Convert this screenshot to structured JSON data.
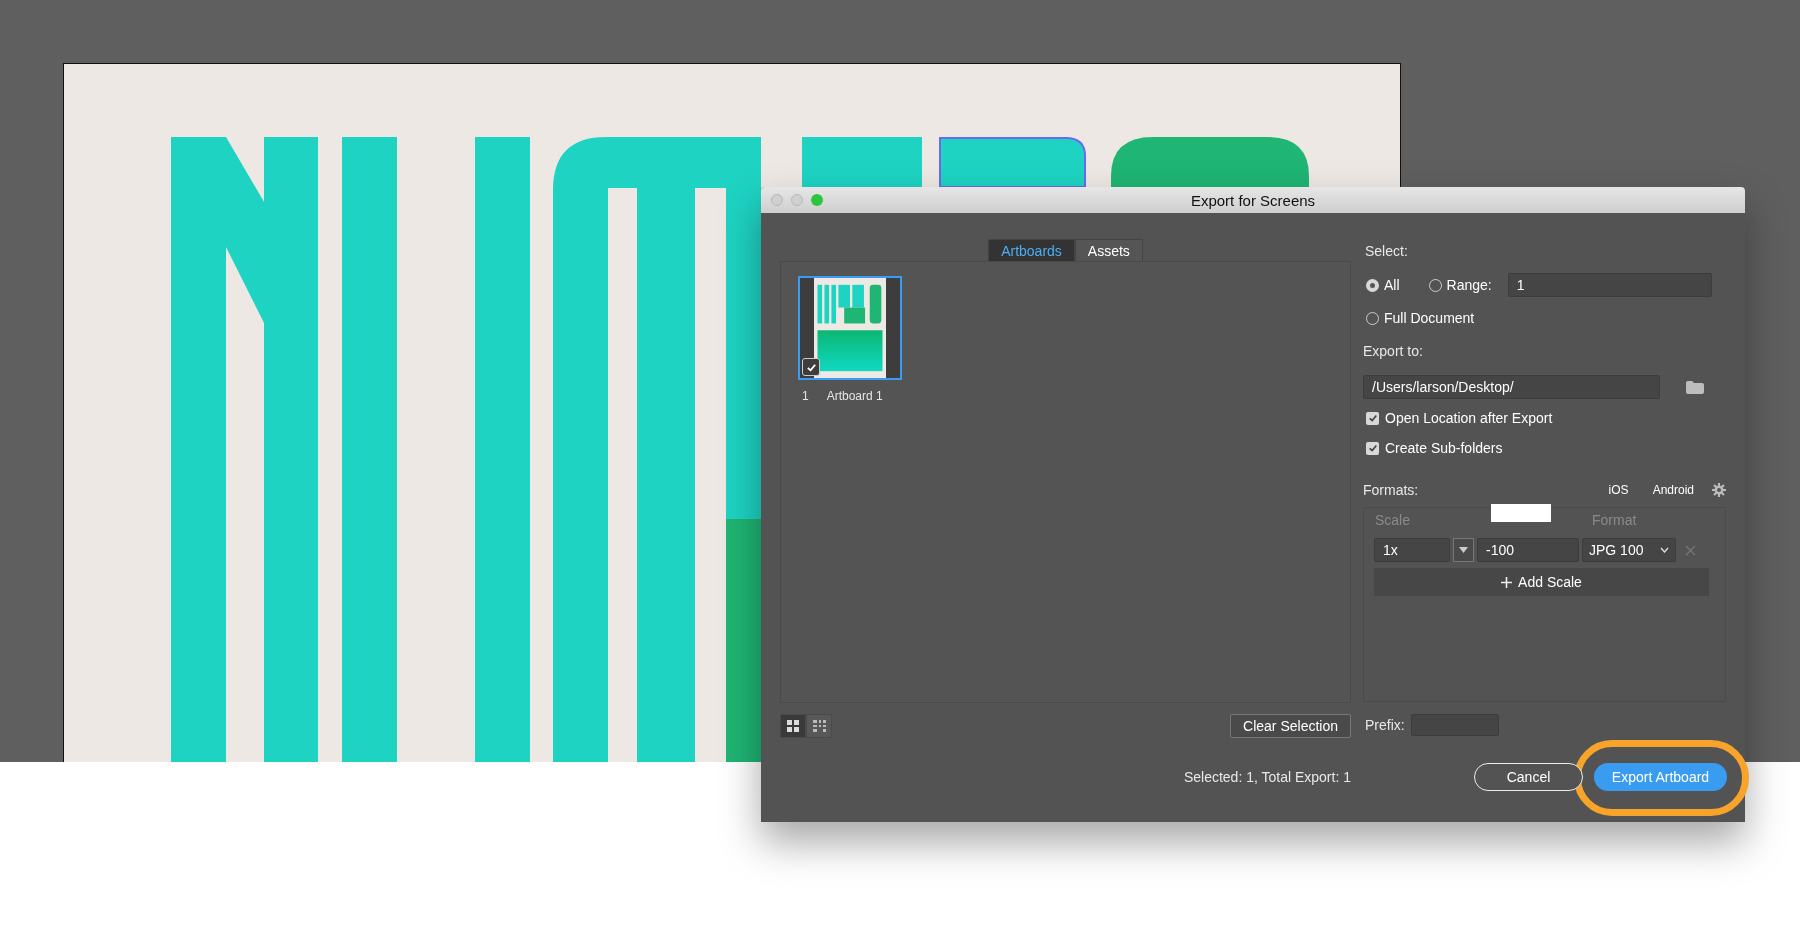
{
  "dialog": {
    "title": "Export for Screens"
  },
  "tabs": [
    {
      "label": "Artboards",
      "selected": true
    },
    {
      "label": "Assets",
      "selected": false
    }
  ],
  "artboards": [
    {
      "number": "1",
      "name": "Artboard 1",
      "checked": true,
      "selected": true
    }
  ],
  "select": {
    "label": "Select:",
    "range_value": "1",
    "options": [
      {
        "label": "All",
        "selected": true
      },
      {
        "label": "Range:",
        "selected": false
      },
      {
        "label": "Full Document",
        "selected": false
      }
    ]
  },
  "export_to": {
    "label": "Export to:",
    "path": "/Users/larson/Desktop/"
  },
  "options": [
    {
      "label": "Open Location after Export",
      "checked": true
    },
    {
      "label": "Create Sub-folders",
      "checked": true
    }
  ],
  "formats": {
    "label": "Formats:",
    "presets": [
      "iOS",
      "Android"
    ],
    "scale_header": "Scale",
    "format_header": "Format",
    "add_label": "Add Scale",
    "rows": [
      {
        "scale": "1x",
        "suffix": "-100",
        "format": "JPG 100"
      }
    ]
  },
  "view_modes": [
    {
      "kind": "grid",
      "selected": true
    },
    {
      "kind": "list",
      "selected": false
    }
  ],
  "clear_selection": "Clear Selection",
  "prefix": {
    "label": "Prefix:"
  },
  "status": "Selected: 1, Total Export: 1",
  "buttons": [
    {
      "label": "Cancel",
      "kind": "secondary",
      "highlighted": false
    },
    {
      "label": "Export Artboard",
      "kind": "primary",
      "highlighted": true
    }
  ]
}
